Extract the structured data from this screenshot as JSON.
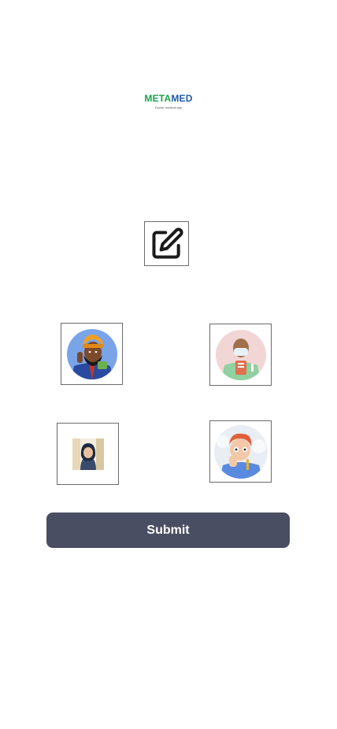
{
  "logo": {
    "word_part1": "META",
    "word_part2": "MED",
    "tagline": "Doctor medical app",
    "colors": {
      "green": "#1aa34a",
      "blue": "#1e5aa8"
    }
  },
  "edit": {
    "icon": "edit-icon"
  },
  "avatars": [
    {
      "icon": "avatar-turban-man"
    },
    {
      "icon": "avatar-doctor-mask"
    },
    {
      "icon": "avatar-woman-photo"
    },
    {
      "icon": "avatar-red-hair-boy"
    }
  ],
  "submit": {
    "label": "Submit",
    "color": "#4a4e62"
  }
}
